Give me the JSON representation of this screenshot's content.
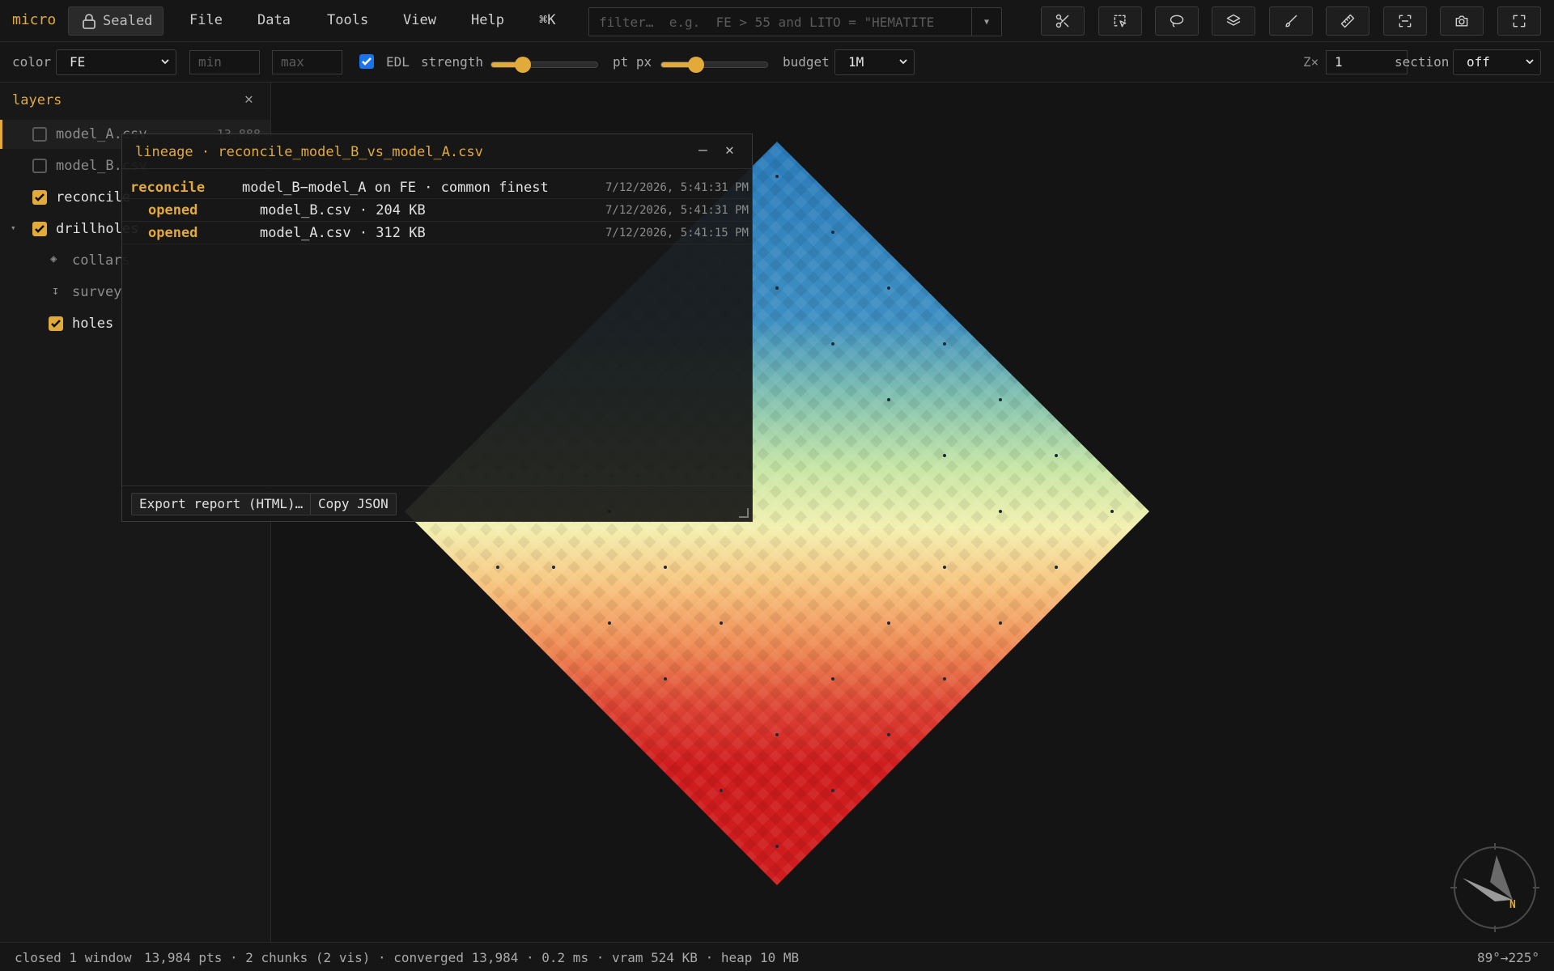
{
  "app": {
    "brand": "micro",
    "sealed_label": "Sealed"
  },
  "menu": [
    "File",
    "Data",
    "Tools",
    "View",
    "Help",
    "⌘K"
  ],
  "filter": {
    "placeholder": "filter…  e.g.  FE > 55 and LITO = \"HEMATITE",
    "value": ""
  },
  "tools": [
    "scissors-icon",
    "select-box-icon",
    "lasso-icon",
    "layers-icon",
    "brush-icon",
    "ruler-icon",
    "frame-icon",
    "camera-icon",
    "fullscreen-icon"
  ],
  "toolbar": {
    "color_label": "color",
    "color_value": "FE",
    "min_placeholder": "min",
    "max_placeholder": "max",
    "edl_label": "EDL",
    "edl_checked": true,
    "strength_label": "strength",
    "strength_level": 0.3,
    "ptpx_label": "pt px",
    "ptpx_level": 0.33,
    "budget_label": "budget",
    "budget_value": "1M",
    "zx_label": "Z×",
    "zx_value": "1",
    "section_label": "section",
    "section_value": "off"
  },
  "layers": {
    "title": "layers",
    "items": [
      {
        "name": "model_A.csv",
        "checked": false,
        "count": "13,888"
      },
      {
        "name": "model_B.csv",
        "checked": false,
        "count": ""
      },
      {
        "name": "reconcile",
        "checked": true,
        "count": ""
      },
      {
        "name": "drillholes",
        "checked": true,
        "count": ""
      },
      {
        "name": "collars",
        "icon": "diamond-icon"
      },
      {
        "name": "survey",
        "icon": "arrow-down-icon"
      },
      {
        "name": "holes",
        "checked": true
      }
    ]
  },
  "lineage": {
    "title": "lineage · reconcile_model_B_vs_model_A.csv",
    "rows": [
      {
        "kind": "reconcile",
        "desc": "model_B−model_A on FE · common finest",
        "time": "7/12/2026, 5:41:31 PM"
      },
      {
        "kind": "opened",
        "desc": "model_B.csv · 204 KB",
        "time": "7/12/2026, 5:41:31 PM"
      },
      {
        "kind": "opened",
        "desc": "model_A.csv · 312 KB",
        "time": "7/12/2026, 5:41:15 PM"
      }
    ],
    "export_label": "Export report (HTML)…",
    "copy_label": "Copy JSON"
  },
  "compass": {
    "label": "N"
  },
  "status": {
    "message": "closed 1 window",
    "stats": "13,984 pts · 2 chunks (2 vis) · converged 13,984 · 0.2 ms · vram 524 KB · heap 10 MB",
    "orientation": "89°→225°"
  },
  "colors": {
    "accent": "#e2a93b",
    "checkbox_blue": "#1a73e8",
    "bg": "#141414"
  }
}
